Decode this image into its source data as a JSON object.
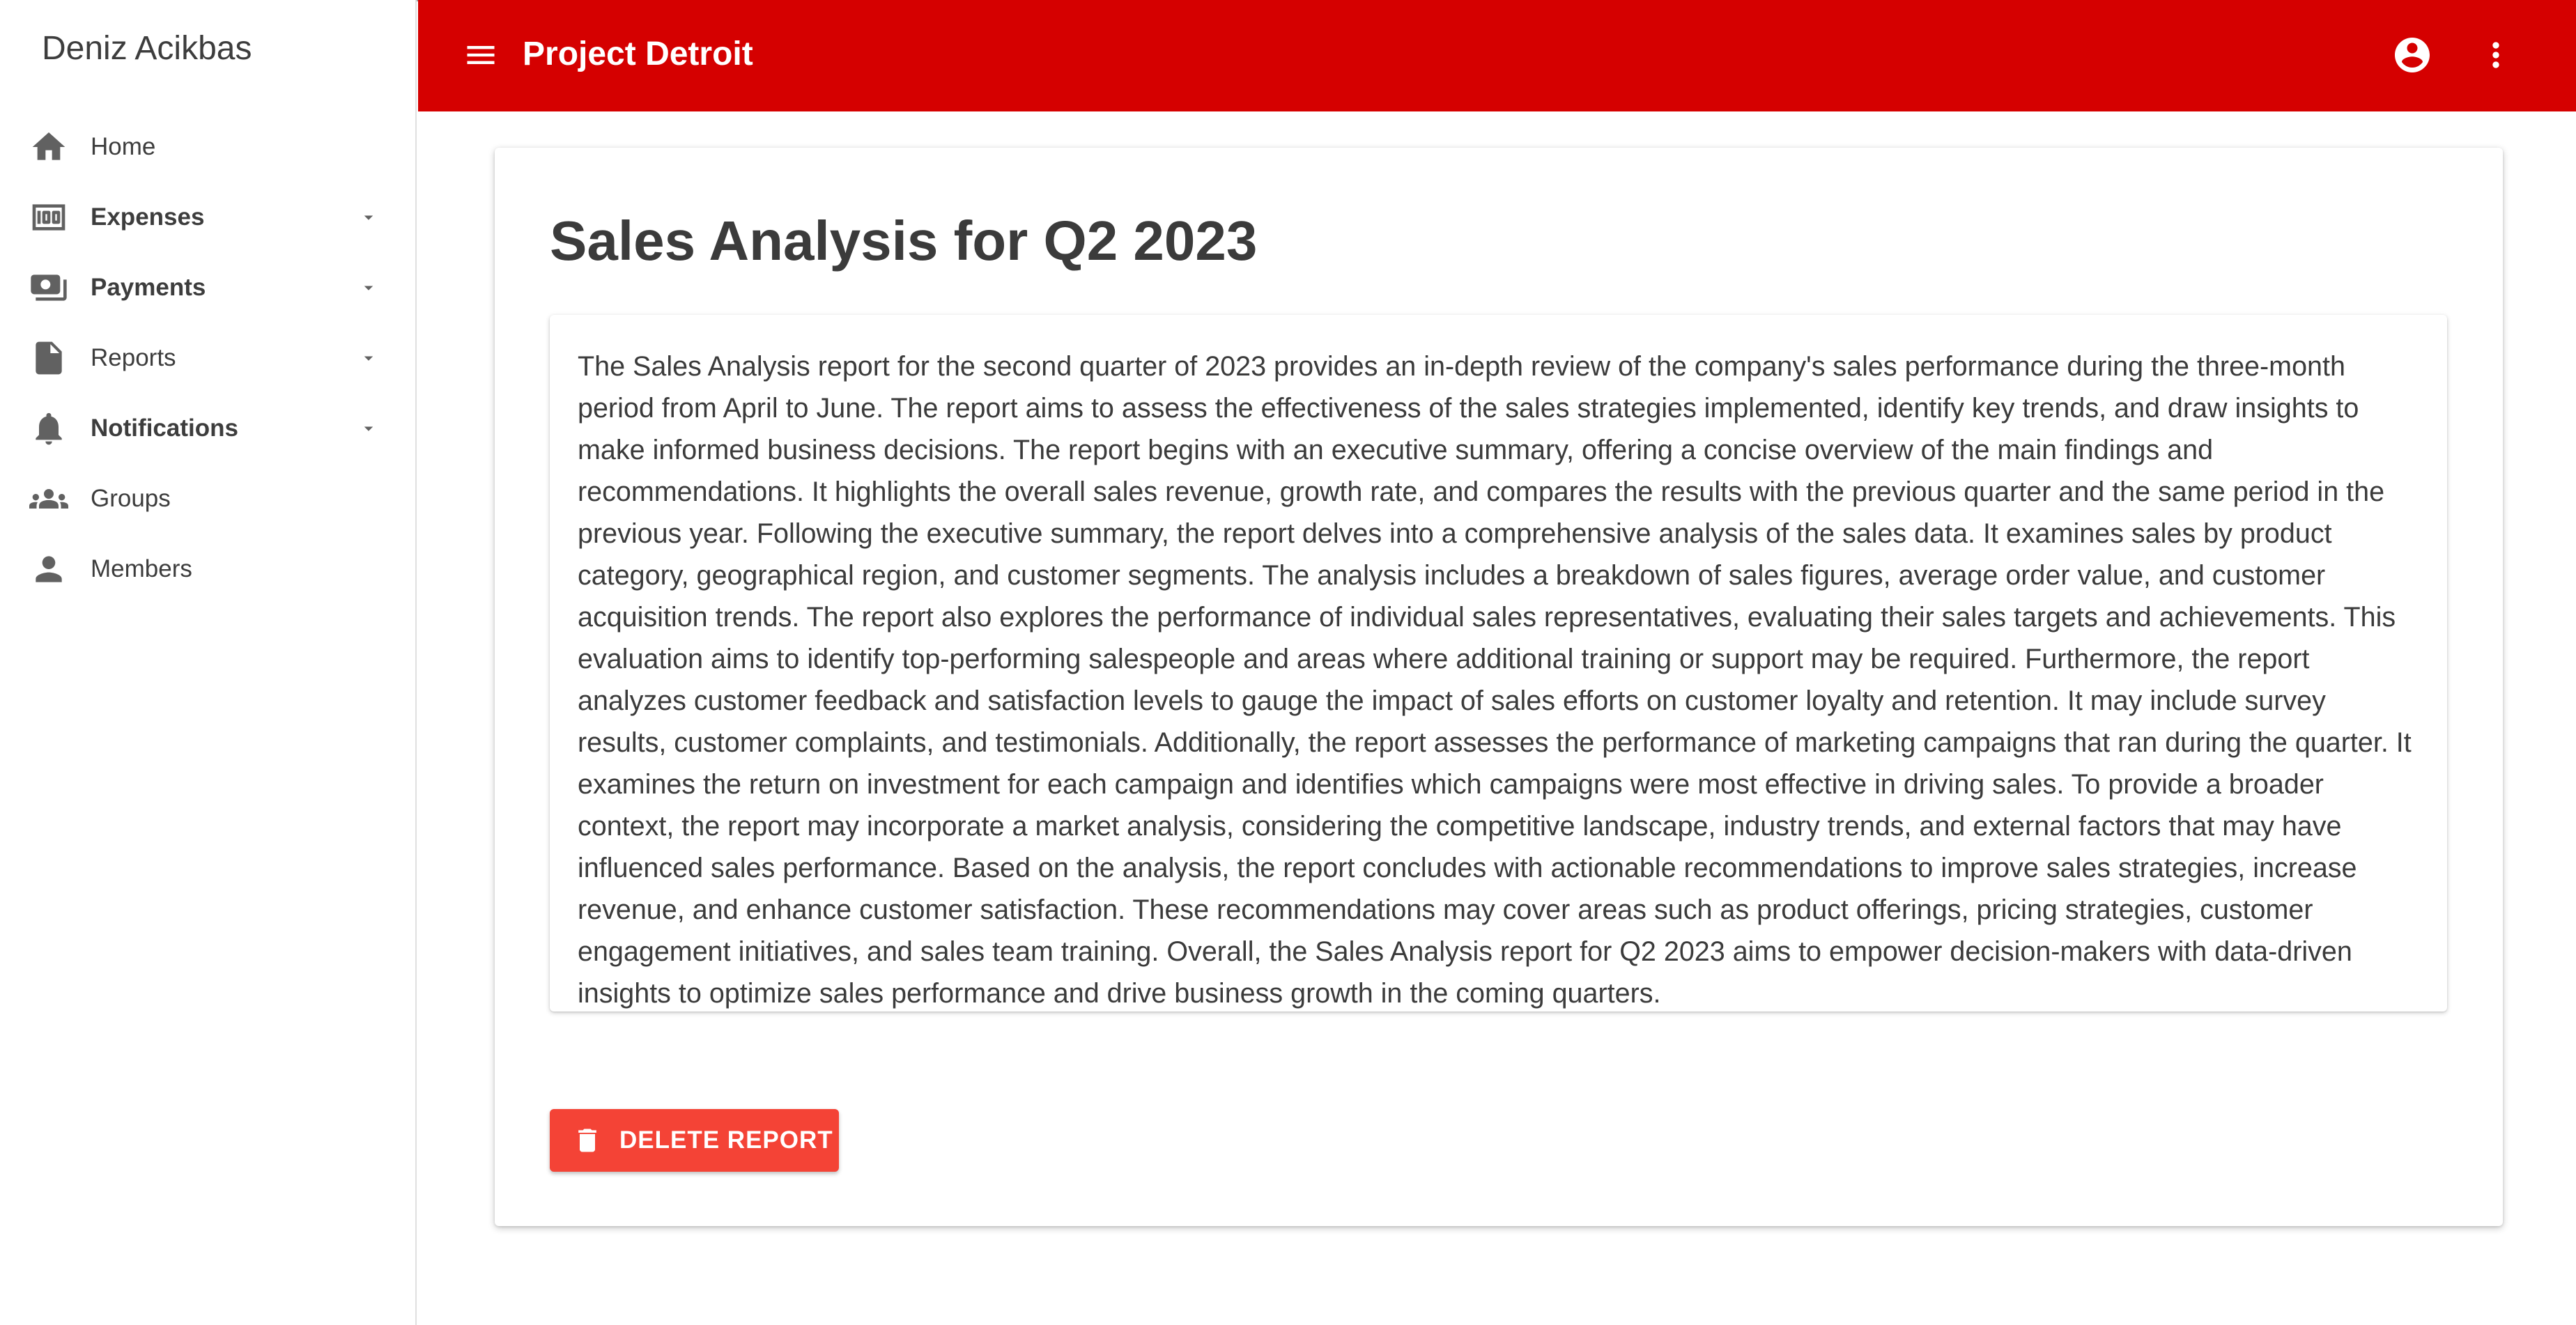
{
  "sidebar": {
    "user_name": "Deniz Acikbas",
    "items": [
      {
        "label": "Home",
        "icon": "home-icon",
        "expandable": false
      },
      {
        "label": "Expenses",
        "icon": "money-icon",
        "expandable": true
      },
      {
        "label": "Payments",
        "icon": "payments-icon",
        "expandable": true
      },
      {
        "label": "Reports",
        "icon": "document-icon",
        "expandable": true
      },
      {
        "label": "Notifications",
        "icon": "bell-icon",
        "expandable": true
      },
      {
        "label": "Groups",
        "icon": "groups-icon",
        "expandable": false
      },
      {
        "label": "Members",
        "icon": "person-icon",
        "expandable": false
      }
    ]
  },
  "appbar": {
    "title": "Project Detroit",
    "menu_icon": "hamburger-menu-icon",
    "account_icon": "account-circle-icon",
    "more_icon": "more-vert-icon",
    "color": "#d50000"
  },
  "report": {
    "title": "Sales Analysis for Q2 2023",
    "body": "The Sales Analysis report for the second quarter of 2023 provides an in-depth review of the company's sales performance during the three-month period from April to June. The report aims to assess the effectiveness of the sales strategies implemented, identify key trends, and draw insights to make informed business decisions. The report begins with an executive summary, offering a concise overview of the main findings and recommendations. It highlights the overall sales revenue, growth rate, and compares the results with the previous quarter and the same period in the previous year. Following the executive summary, the report delves into a comprehensive analysis of the sales data. It examines sales by product category, geographical region, and customer segments. The analysis includes a breakdown of sales figures, average order value, and customer acquisition trends. The report also explores the performance of individual sales representatives, evaluating their sales targets and achievements. This evaluation aims to identify top-performing salespeople and areas where additional training or support may be required. Furthermore, the report analyzes customer feedback and satisfaction levels to gauge the impact of sales efforts on customer loyalty and retention. It may include survey results, customer complaints, and testimonials. Additionally, the report assesses the performance of marketing campaigns that ran during the quarter. It examines the return on investment for each campaign and identifies which campaigns were most effective in driving sales. To provide a broader context, the report may incorporate a market analysis, considering the competitive landscape, industry trends, and external factors that may have influenced sales performance. Based on the analysis, the report concludes with actionable recommendations to improve sales strategies, increase revenue, and enhance customer satisfaction. These recommendations may cover areas such as product offerings, pricing strategies, customer engagement initiatives, and sales team training. Overall, the Sales Analysis report for Q2 2023 aims to empower decision-makers with data-driven insights to optimize sales performance and drive business growth in the coming quarters.",
    "delete_label": "DELETE REPORT",
    "delete_icon": "trash-icon",
    "delete_color": "#f44336"
  }
}
